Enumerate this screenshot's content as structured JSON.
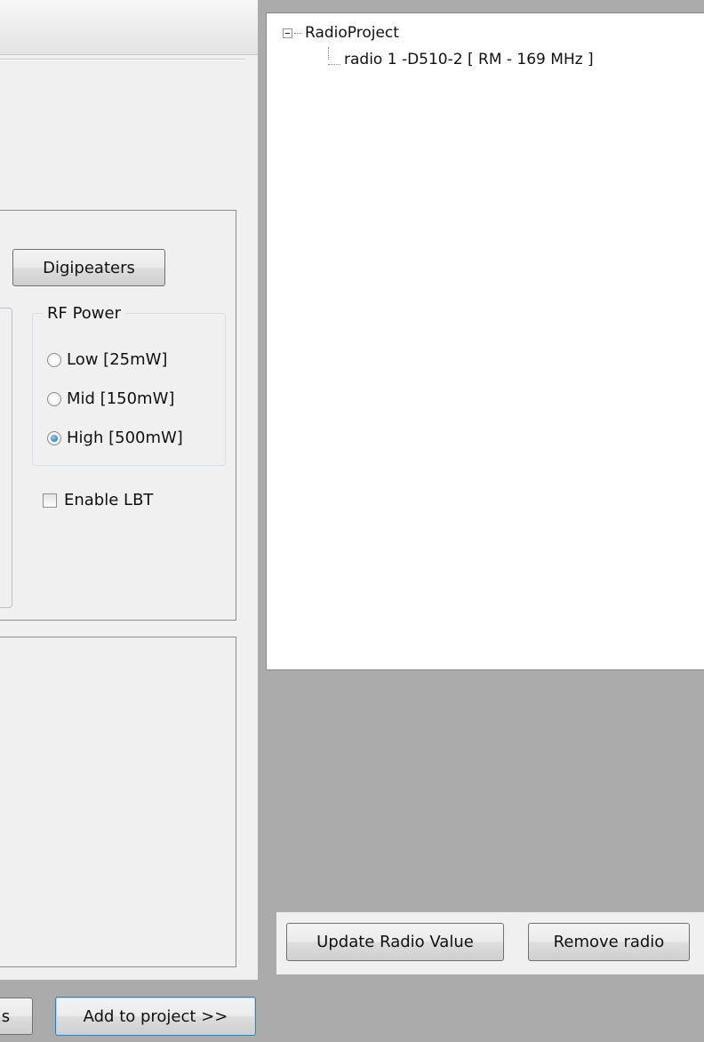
{
  "config_panel": {
    "digipeaters_label": "Digipeaters",
    "rf_power": {
      "legend": "RF Power",
      "options": [
        {
          "label": "Low [25mW]",
          "selected": false
        },
        {
          "label": "Mid [150mW]",
          "selected": false
        },
        {
          "label": "High [500mW]",
          "selected": true
        }
      ]
    },
    "lbt": {
      "label": "Enable LBT",
      "checked": false
    }
  },
  "tree": {
    "root": "RadioProject",
    "children": [
      "radio 1 -D510-2 [ RM - 169 MHz ]"
    ]
  },
  "tree_actions": {
    "update_label": "Update Radio Value",
    "remove_label": "Remove radio"
  },
  "footer": {
    "partial_button_label": "s",
    "add_label": "Add to project >>"
  }
}
